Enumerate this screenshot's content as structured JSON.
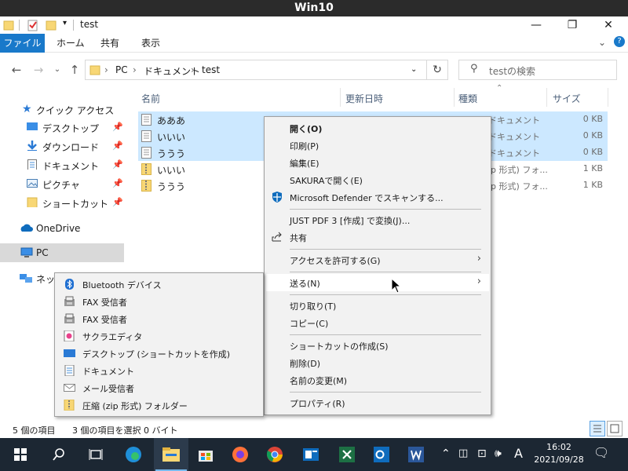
{
  "vm": {
    "title": "Win10"
  },
  "window": {
    "title": "test"
  },
  "ribbon": {
    "tabs": [
      "ファイル",
      "ホーム",
      "共有",
      "表示"
    ]
  },
  "address": {
    "crumbs": [
      "PC",
      "ドキュメント",
      "test"
    ],
    "search_placeholder": "testの検索"
  },
  "nav": {
    "items": [
      {
        "label": "クイック アクセス",
        "icon": "star-icon"
      },
      {
        "label": "デスクトップ",
        "icon": "desktop-icon",
        "pinned": true
      },
      {
        "label": "ダウンロード",
        "icon": "download-icon",
        "pinned": true
      },
      {
        "label": "ドキュメント",
        "icon": "document-icon",
        "pinned": true
      },
      {
        "label": "ピクチャ",
        "icon": "picture-icon",
        "pinned": true
      },
      {
        "label": "ショートカット",
        "icon": "folder-icon",
        "pinned": true
      },
      {
        "label": "OneDrive",
        "icon": "cloud-icon"
      },
      {
        "label": "PC",
        "icon": "pc-icon",
        "selected": true
      },
      {
        "label": "ネッ",
        "icon": "network-icon"
      }
    ]
  },
  "list": {
    "headers": {
      "name": "名前",
      "date": "更新日時",
      "type": "種類",
      "size": "サイズ"
    },
    "rows": [
      {
        "name": "あああ",
        "type": "ドキュメント",
        "size": "0 KB",
        "selected": true,
        "kind": "text"
      },
      {
        "name": "いいい",
        "type": "ドキュメント",
        "size": "0 KB",
        "selected": true,
        "kind": "text"
      },
      {
        "name": "ううう",
        "type": "ドキュメント",
        "size": "0 KB",
        "selected": true,
        "kind": "text"
      },
      {
        "name": "いいい",
        "type": "ip 形式) フォ...",
        "size": "1 KB",
        "selected": false,
        "kind": "zip"
      },
      {
        "name": "ううう",
        "type": "ip 形式) フォ...",
        "size": "1 KB",
        "selected": false,
        "kind": "zip"
      }
    ]
  },
  "status": {
    "count": "5 個の項目",
    "selection": "3 個の項目を選択  0 バイト"
  },
  "context_menu": {
    "open": "開く(O)",
    "print": "印刷(P)",
    "edit": "編集(E)",
    "sakura": "SAKURAで開く(E)",
    "defender": "Microsoft Defender でスキャンする...",
    "justpdf": "JUST PDF 3 [作成] で変換(J)...",
    "share": "共有",
    "access": "アクセスを許可する(G)",
    "sendto": "送る(N)",
    "cut": "切り取り(T)",
    "copy": "コピー(C)",
    "shortcut": "ショートカットの作成(S)",
    "delete": "削除(D)",
    "rename": "名前の変更(M)",
    "properties": "プロパティ(R)"
  },
  "sendto_menu": [
    {
      "label": "Bluetooth デバイス",
      "icon": "bluetooth-icon"
    },
    {
      "label": "FAX 受信者",
      "icon": "fax-icon"
    },
    {
      "label": "FAX 受信者",
      "icon": "fax-icon"
    },
    {
      "label": "サクラエディタ",
      "icon": "sakura-editor-icon"
    },
    {
      "label": "デスクトップ (ショートカットを作成)",
      "icon": "desktop-icon"
    },
    {
      "label": "ドキュメント",
      "icon": "document-icon"
    },
    {
      "label": "メール受信者",
      "icon": "mail-icon"
    },
    {
      "label": "圧縮 (zip 形式) フォルダー",
      "icon": "zip-folder-icon"
    }
  ],
  "taskbar": {
    "time": "16:02",
    "date": "2021/09/28",
    "ime": "A",
    "apps": [
      "start-icon",
      "search-icon",
      "task-view-icon",
      "edge-icon",
      "file-explorer-icon",
      "store-icon",
      "firefox-icon",
      "chrome-icon",
      "outlook-contacts-icon",
      "excel-icon",
      "outlook-icon",
      "word-icon"
    ]
  },
  "colors": {
    "accent": "#1979ca",
    "selection": "#cce8ff",
    "taskbar": "#1c2733"
  }
}
